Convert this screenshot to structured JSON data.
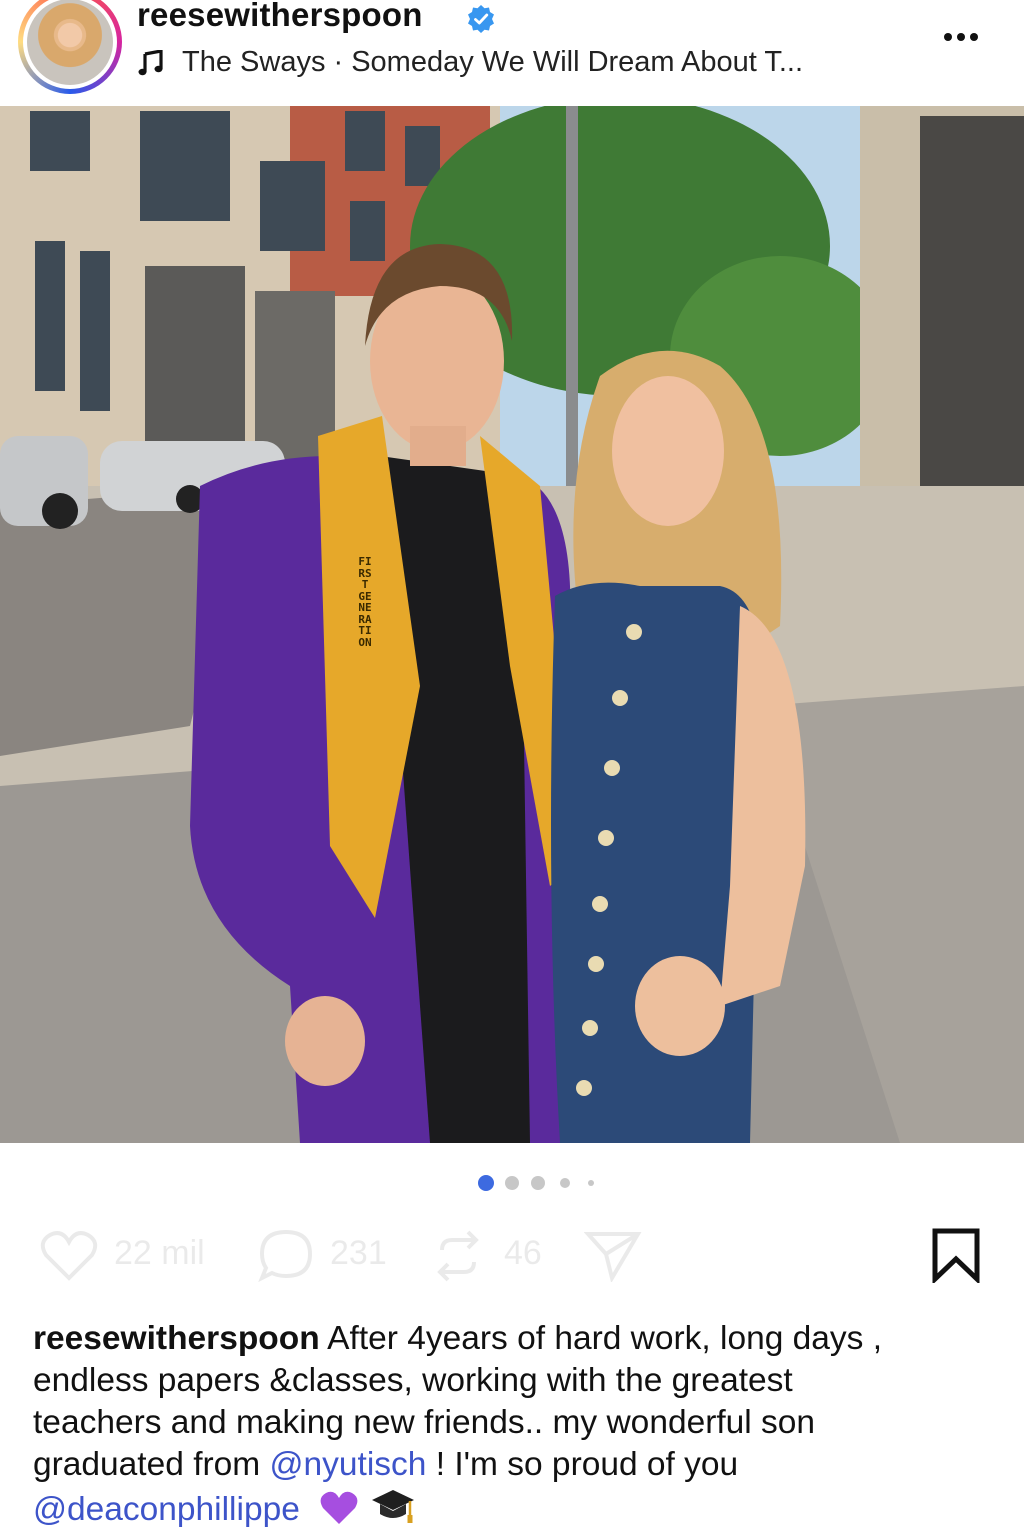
{
  "header": {
    "username": "reesewitherspoon",
    "verified": true,
    "music": "The Sways · Someday We Will Dream About T...",
    "avatar_icon": "profile-avatar",
    "more_icon": "more-options-icon"
  },
  "photo": {
    "stole_text": "FIRST GENERATION",
    "tag_icon": "user-tag-icon",
    "sound_icon": "speaker-icon"
  },
  "carousel": {
    "count": 5,
    "active_index": 0
  },
  "actions": {
    "likes": "22 mil",
    "comments": "231",
    "reposts": "46",
    "save_icon": "bookmark-icon"
  },
  "caption": {
    "user": "reesewitherspoon",
    "text_line1": " After 4years of hard work, long days ,",
    "text_line2": "endless papers &classes, working with the greatest",
    "text_line3": "teachers and making new friends.. my wonderful son",
    "text_line4_pre": "graduated from ",
    "mention1": "@nyutisch",
    "text_line4_post": " ! I'm so proud of you",
    "mention2": "@deaconphillippe"
  },
  "colors": {
    "mention": "#3d54c9",
    "verified": "#3897f0",
    "active_dot": "#3d6ae0"
  }
}
